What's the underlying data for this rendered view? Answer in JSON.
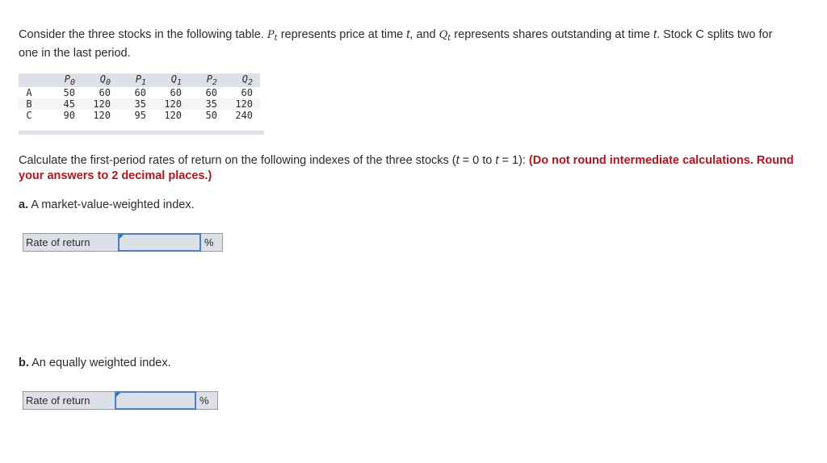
{
  "intro": {
    "t1": "Consider the three stocks in the following table. ",
    "p_sym": "P",
    "p_sub": "t",
    "t2": " represents price at time ",
    "t_sym": "t",
    "t3": ", and ",
    "q_sym": "Q",
    "q_sub": "t",
    "t4": " represents shares outstanding at time ",
    "t_sym2": "t",
    "t5": ". Stock C splits two for one in the last period."
  },
  "table": {
    "headers": [
      {
        "sym": "P",
        "sub": "0"
      },
      {
        "sym": "Q",
        "sub": "0"
      },
      {
        "sym": "P",
        "sub": "1"
      },
      {
        "sym": "Q",
        "sub": "1"
      },
      {
        "sym": "P",
        "sub": "2"
      },
      {
        "sym": "Q",
        "sub": "2"
      }
    ],
    "rows": [
      {
        "label": "A",
        "values": [
          "50",
          "60",
          "60",
          "60",
          "60",
          "60"
        ]
      },
      {
        "label": "B",
        "values": [
          "45",
          "120",
          "35",
          "120",
          "35",
          "120"
        ]
      },
      {
        "label": "C",
        "values": [
          "90",
          "120",
          "95",
          "120",
          "50",
          "240"
        ]
      }
    ]
  },
  "question": {
    "t1": "Calculate the first-period rates of return on the following indexes of the three stocks (",
    "t_a": "t",
    "t2": " = 0 to ",
    "t_b": "t",
    "t3": " = 1): ",
    "instruction": "(Do not round intermediate calculations. Round your answers to 2 decimal places.)"
  },
  "parts": {
    "a": {
      "letter": "a.",
      "text": " A market-value-weighted index.",
      "label": "Rate of return",
      "value": "",
      "unit": "%"
    },
    "b": {
      "letter": "b.",
      "text": " An equally weighted index.",
      "label": "Rate of return",
      "value": "",
      "unit": "%"
    }
  },
  "colors": {
    "instruction_red": "#b0151f",
    "input_border": "#4a7fc1",
    "table_header_bg": "#dde0e8"
  }
}
